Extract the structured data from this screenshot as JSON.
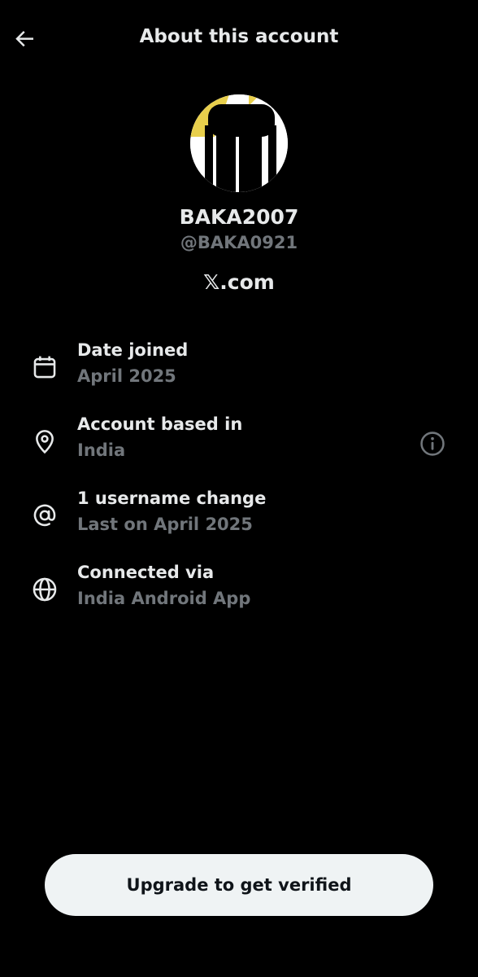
{
  "header": {
    "title": "About this account",
    "back_icon": "arrow-left-icon"
  },
  "profile": {
    "display_name": "BAKA2007",
    "handle": "@BAKA0921",
    "site": "𝕏.com",
    "avatar_icon": "avatar-silhouette"
  },
  "details": [
    {
      "icon": "calendar-icon",
      "title": "Date joined",
      "value": "April 2025"
    },
    {
      "icon": "location-pin-icon",
      "title": "Account based in",
      "value": "India",
      "trailing_icon": "info-icon"
    },
    {
      "icon": "at-sign-icon",
      "title": "1 username change",
      "value": "Last on April 2025"
    },
    {
      "icon": "globe-icon",
      "title": "Connected via",
      "value": "India Android App"
    }
  ],
  "footer": {
    "upgrade_label": "Upgrade to get verified"
  },
  "colors": {
    "background": "#000000",
    "primary_text": "#e7e9ea",
    "secondary_text": "#71767b",
    "button_bg": "#eff3f4",
    "button_text": "#0f1419"
  }
}
